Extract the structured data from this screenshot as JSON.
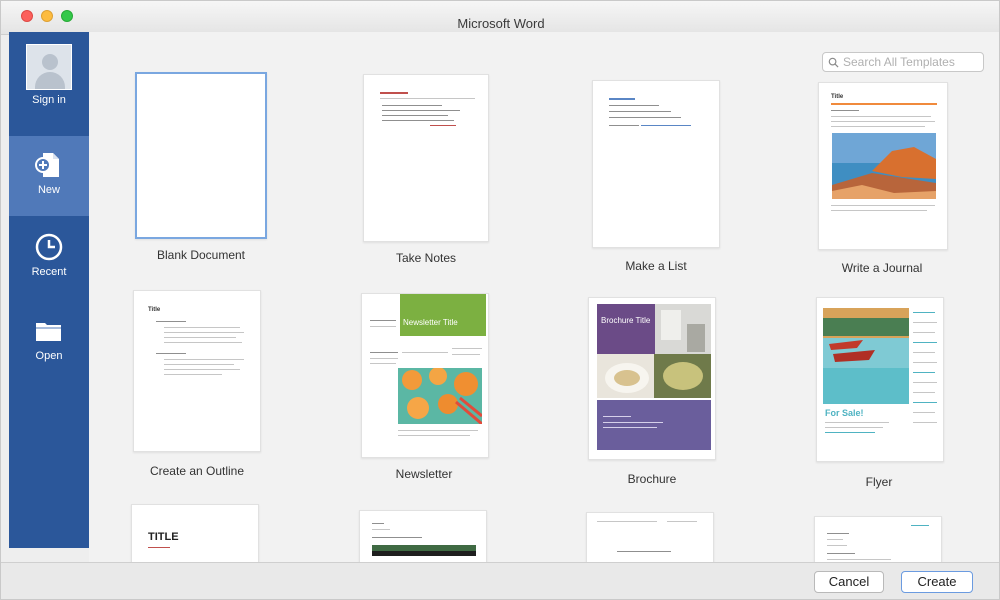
{
  "window": {
    "title": "Microsoft Word"
  },
  "sidebar": {
    "items": [
      {
        "label": "Sign in",
        "icon": "avatar-icon"
      },
      {
        "label": "New",
        "icon": "new-document-icon"
      },
      {
        "label": "Recent",
        "icon": "clock-icon"
      },
      {
        "label": "Open",
        "icon": "folder-icon"
      }
    ]
  },
  "search": {
    "placeholder": "Search All Templates"
  },
  "templates": [
    {
      "label": "Blank Document"
    },
    {
      "label": "Take Notes"
    },
    {
      "label": "Make a List"
    },
    {
      "label": "Write a Journal"
    },
    {
      "label": "Create an Outline"
    },
    {
      "label": "Newsletter"
    },
    {
      "label": "Brochure"
    },
    {
      "label": "Flyer"
    }
  ],
  "thumb_text": {
    "journal_title": "Title",
    "outline_title": "Title",
    "newsletter_title": "Newsletter Title",
    "brochure_title": "Brochure Title",
    "flyer_title": "For Sale!",
    "row3_title": "TITLE"
  },
  "buttons": {
    "cancel": "Cancel",
    "create": "Create"
  },
  "colors": {
    "sidebar": "#2b579a",
    "sidebar_selected": "#5079b9"
  }
}
